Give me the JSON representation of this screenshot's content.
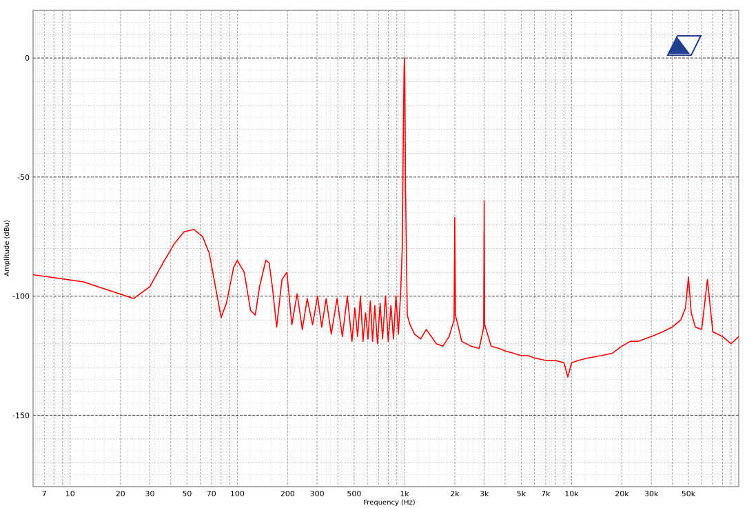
{
  "chart_data": {
    "type": "line",
    "xlabel": "Frequency (Hz)",
    "ylabel": "Amplitude (dBu)",
    "x_scale": "log",
    "xlim": [
      6,
      100000
    ],
    "ylim": [
      -180,
      20
    ],
    "grid": true,
    "x_ticks": [
      {
        "value": 7,
        "label": "7"
      },
      {
        "value": 10,
        "label": "10"
      },
      {
        "value": 20,
        "label": "20"
      },
      {
        "value": 30,
        "label": "30"
      },
      {
        "value": 50,
        "label": "50"
      },
      {
        "value": 70,
        "label": "70"
      },
      {
        "value": 100,
        "label": "100"
      },
      {
        "value": 200,
        "label": "200"
      },
      {
        "value": 300,
        "label": "300"
      },
      {
        "value": 500,
        "label": "500"
      },
      {
        "value": 1000,
        "label": "1k"
      },
      {
        "value": 2000,
        "label": "2k"
      },
      {
        "value": 3000,
        "label": "3k"
      },
      {
        "value": 5000,
        "label": "5k"
      },
      {
        "value": 7000,
        "label": "7k"
      },
      {
        "value": 10000,
        "label": "10k"
      },
      {
        "value": 20000,
        "label": "20k"
      },
      {
        "value": 30000,
        "label": "30k"
      },
      {
        "value": 50000,
        "label": "50k"
      }
    ],
    "y_ticks": [
      {
        "value": 0,
        "label": "0"
      },
      {
        "value": -50,
        "label": "-50"
      },
      {
        "value": -100,
        "label": "-100"
      },
      {
        "value": -150,
        "label": "-150"
      }
    ],
    "series": [
      {
        "color": "#ff0000",
        "x": [
          6,
          12,
          24,
          30,
          36,
          42,
          48,
          55,
          62,
          68,
          74,
          80,
          86,
          95,
          100,
          110,
          120,
          128,
          136,
          148,
          155,
          162,
          172,
          185,
          198,
          212,
          228,
          245,
          262,
          282,
          302,
          320,
          340,
          365,
          395,
          425,
          455,
          485,
          505,
          525,
          545,
          565,
          585,
          605,
          625,
          645,
          665,
          690,
          715,
          740,
          770,
          800,
          830,
          860,
          890,
          920,
          950,
          970,
          985,
          995,
          1000,
          1005,
          1015,
          1040,
          1080,
          1150,
          1250,
          1350,
          1450,
          1550,
          1700,
          1850,
          1980,
          2000,
          2020,
          2200,
          2500,
          2800,
          2980,
          3000,
          3020,
          3300,
          3700,
          4000,
          4500,
          5000,
          5500,
          6000,
          7000,
          8000,
          9000,
          9500,
          10000,
          11000,
          12500,
          15000,
          17500,
          20000,
          22500,
          25000,
          30000,
          35000,
          40000,
          45000,
          48000,
          50000,
          52000,
          55000,
          60000,
          65000,
          70000,
          80000,
          90000,
          100000
        ],
        "y": [
          -91,
          -94,
          -101,
          -96,
          -86,
          -78,
          -73,
          -72,
          -75,
          -82,
          -96,
          -109,
          -103,
          -88,
          -85,
          -90,
          -106,
          -108,
          -96,
          -85,
          -86,
          -96,
          -113,
          -93,
          -90,
          -112,
          -99,
          -114,
          -101,
          -112,
          -100,
          -113,
          -101,
          -116,
          -101,
          -117,
          -100,
          -119,
          -105,
          -117,
          -100,
          -119,
          -107,
          -118,
          -102,
          -119,
          -104,
          -120,
          -103,
          -118,
          -100,
          -119,
          -104,
          -118,
          -100,
          -116,
          -98,
          -80,
          -30,
          -5,
          0,
          -7,
          -55,
          -108,
          -112,
          -116,
          -118,
          -114,
          -117,
          -120,
          -121,
          -117,
          -110,
          -67,
          -108,
          -119,
          -121,
          -122,
          -113,
          -60,
          -112,
          -121,
          -122,
          -123,
          -124,
          -125,
          -125,
          -126,
          -127,
          -127,
          -128,
          -134,
          -128,
          -127,
          -126,
          -125,
          -124,
          -121,
          -119,
          -119,
          -117,
          -115,
          -113,
          -110,
          -105,
          -92,
          -107,
          -113,
          -114,
          -93,
          -115,
          -117,
          -120,
          -117
        ]
      }
    ]
  },
  "logo": {
    "name": "audio-analyzer-logo",
    "color": "#1f3f8f"
  }
}
